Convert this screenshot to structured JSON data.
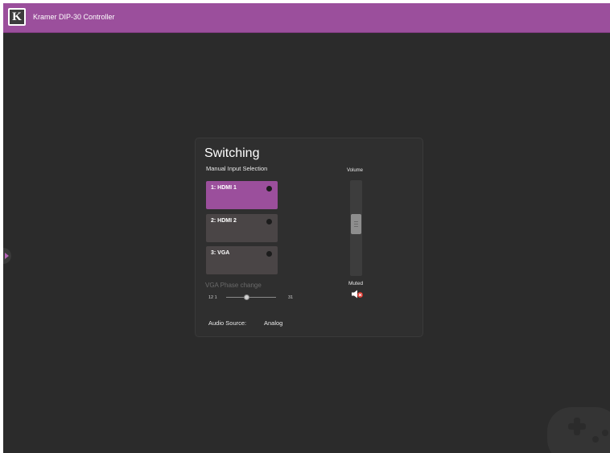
{
  "app": {
    "title": "Kramer DIP-30 Controller"
  },
  "colors": {
    "accent": "#9b4f9c",
    "background": "#2b2b2b",
    "panel": "#2f2f2f"
  },
  "icons": {
    "logo": "kramer-k-logo-icon",
    "side_tab": "expand-arrow-icon",
    "mute": "speaker-muted-icon",
    "watermark": "gamepad-watermark-icon"
  },
  "panel": {
    "title": "Switching",
    "manual_selection_label": "Manual Input Selection",
    "inputs": [
      {
        "label": "1: HDMI 1",
        "active": true
      },
      {
        "label": "2: HDMI 2",
        "active": false
      },
      {
        "label": "3: VGA",
        "active": false
      }
    ],
    "vga_phase": {
      "label": "VGA Phase change",
      "value": "12 1",
      "max": "31"
    },
    "audio_source": {
      "label": "Audio Source:",
      "value": "Analog"
    },
    "volume": {
      "label": "Volume",
      "status": "Muted",
      "level_fraction": 0.55
    }
  }
}
